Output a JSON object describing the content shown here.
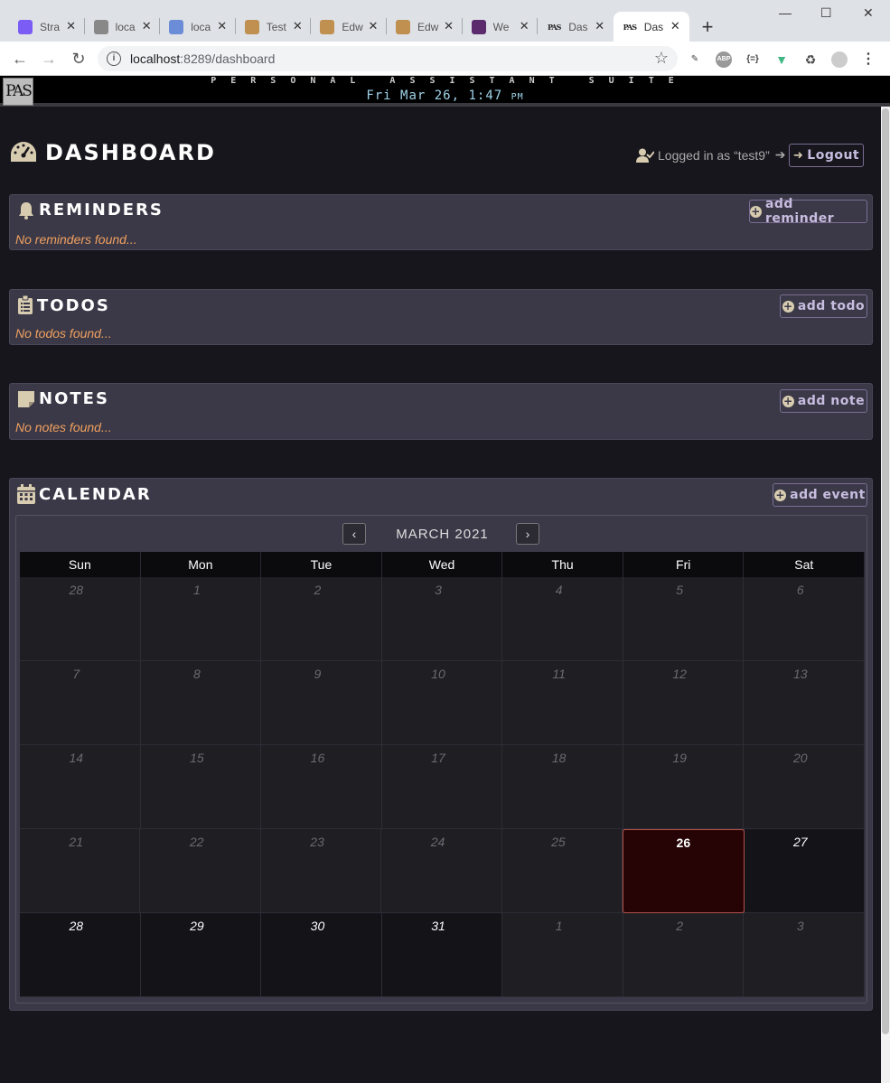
{
  "browser": {
    "tabs": [
      {
        "title": "Stra",
        "icon": "strapi-icon",
        "color": "#7b5cf5"
      },
      {
        "title": "loca",
        "icon": "gear-icon",
        "color": "#888888"
      },
      {
        "title": "loca",
        "icon": "graphql-icon",
        "color": "#6b8cd6"
      },
      {
        "title": "Test",
        "icon": "edwin-icon",
        "color": "#c09050"
      },
      {
        "title": "Edw",
        "icon": "edwin-icon",
        "color": "#c09050"
      },
      {
        "title": "Edw",
        "icon": "edwin-icon",
        "color": "#c09050"
      },
      {
        "title": "We",
        "icon": "webpack-icon",
        "color": "#5b2b6e"
      },
      {
        "title": "Das",
        "icon": "pas-icon",
        "color": "#222222"
      },
      {
        "title": "Das",
        "icon": "pas-icon",
        "color": "#222222"
      }
    ],
    "url_host": "localhost",
    "url_rest": ":8289/dashboard",
    "favicon_text": "PAS"
  },
  "app": {
    "logo": "PAS",
    "suite_title": "PERSONAL ASSISTANT SUITE",
    "clock": "Fri Mar 26, 1:47",
    "clock_ampm": "PM"
  },
  "dashboard": {
    "title": "DASHBOARD",
    "logged_in": "Logged in as “test9”",
    "logged_arrow": "➔",
    "logout_label": "Logout"
  },
  "reminders": {
    "title": "REMINDERS",
    "add_label": "add reminder",
    "empty": "No reminders found..."
  },
  "todos": {
    "title": "TODOS",
    "add_label": "add todo",
    "empty": "No todos found..."
  },
  "notes": {
    "title": "NOTES",
    "add_label": "add note",
    "empty": "No notes found..."
  },
  "calendar": {
    "title": "CALENDAR",
    "add_label": "add event",
    "month_label": "MARCH 2021",
    "prev": "‹",
    "next": "›",
    "days_of_week": [
      "Sun",
      "Mon",
      "Tue",
      "Wed",
      "Thu",
      "Fri",
      "Sat"
    ],
    "weeks": [
      [
        {
          "d": "28",
          "s": "other"
        },
        {
          "d": "1",
          "s": "other"
        },
        {
          "d": "2",
          "s": "other"
        },
        {
          "d": "3",
          "s": "other"
        },
        {
          "d": "4",
          "s": "other"
        },
        {
          "d": "5",
          "s": "other"
        },
        {
          "d": "6",
          "s": "other"
        }
      ],
      [
        {
          "d": "7",
          "s": "other"
        },
        {
          "d": "8",
          "s": "other"
        },
        {
          "d": "9",
          "s": "other"
        },
        {
          "d": "10",
          "s": "other"
        },
        {
          "d": "11",
          "s": "other"
        },
        {
          "d": "12",
          "s": "other"
        },
        {
          "d": "13",
          "s": "other"
        }
      ],
      [
        {
          "d": "14",
          "s": "other"
        },
        {
          "d": "15",
          "s": "other"
        },
        {
          "d": "16",
          "s": "other"
        },
        {
          "d": "17",
          "s": "other"
        },
        {
          "d": "18",
          "s": "other"
        },
        {
          "d": "19",
          "s": "other"
        },
        {
          "d": "20",
          "s": "other"
        }
      ],
      [
        {
          "d": "21",
          "s": "other"
        },
        {
          "d": "22",
          "s": "other"
        },
        {
          "d": "23",
          "s": "other"
        },
        {
          "d": "24",
          "s": "other"
        },
        {
          "d": "25",
          "s": "other"
        },
        {
          "d": "26",
          "s": "today"
        },
        {
          "d": "27",
          "s": "cur"
        }
      ],
      [
        {
          "d": "28",
          "s": "cur"
        },
        {
          "d": "29",
          "s": "cur"
        },
        {
          "d": "30",
          "s": "cur"
        },
        {
          "d": "31",
          "s": "cur"
        },
        {
          "d": "1",
          "s": "other"
        },
        {
          "d": "2",
          "s": "other"
        },
        {
          "d": "3",
          "s": "other"
        }
      ]
    ]
  }
}
